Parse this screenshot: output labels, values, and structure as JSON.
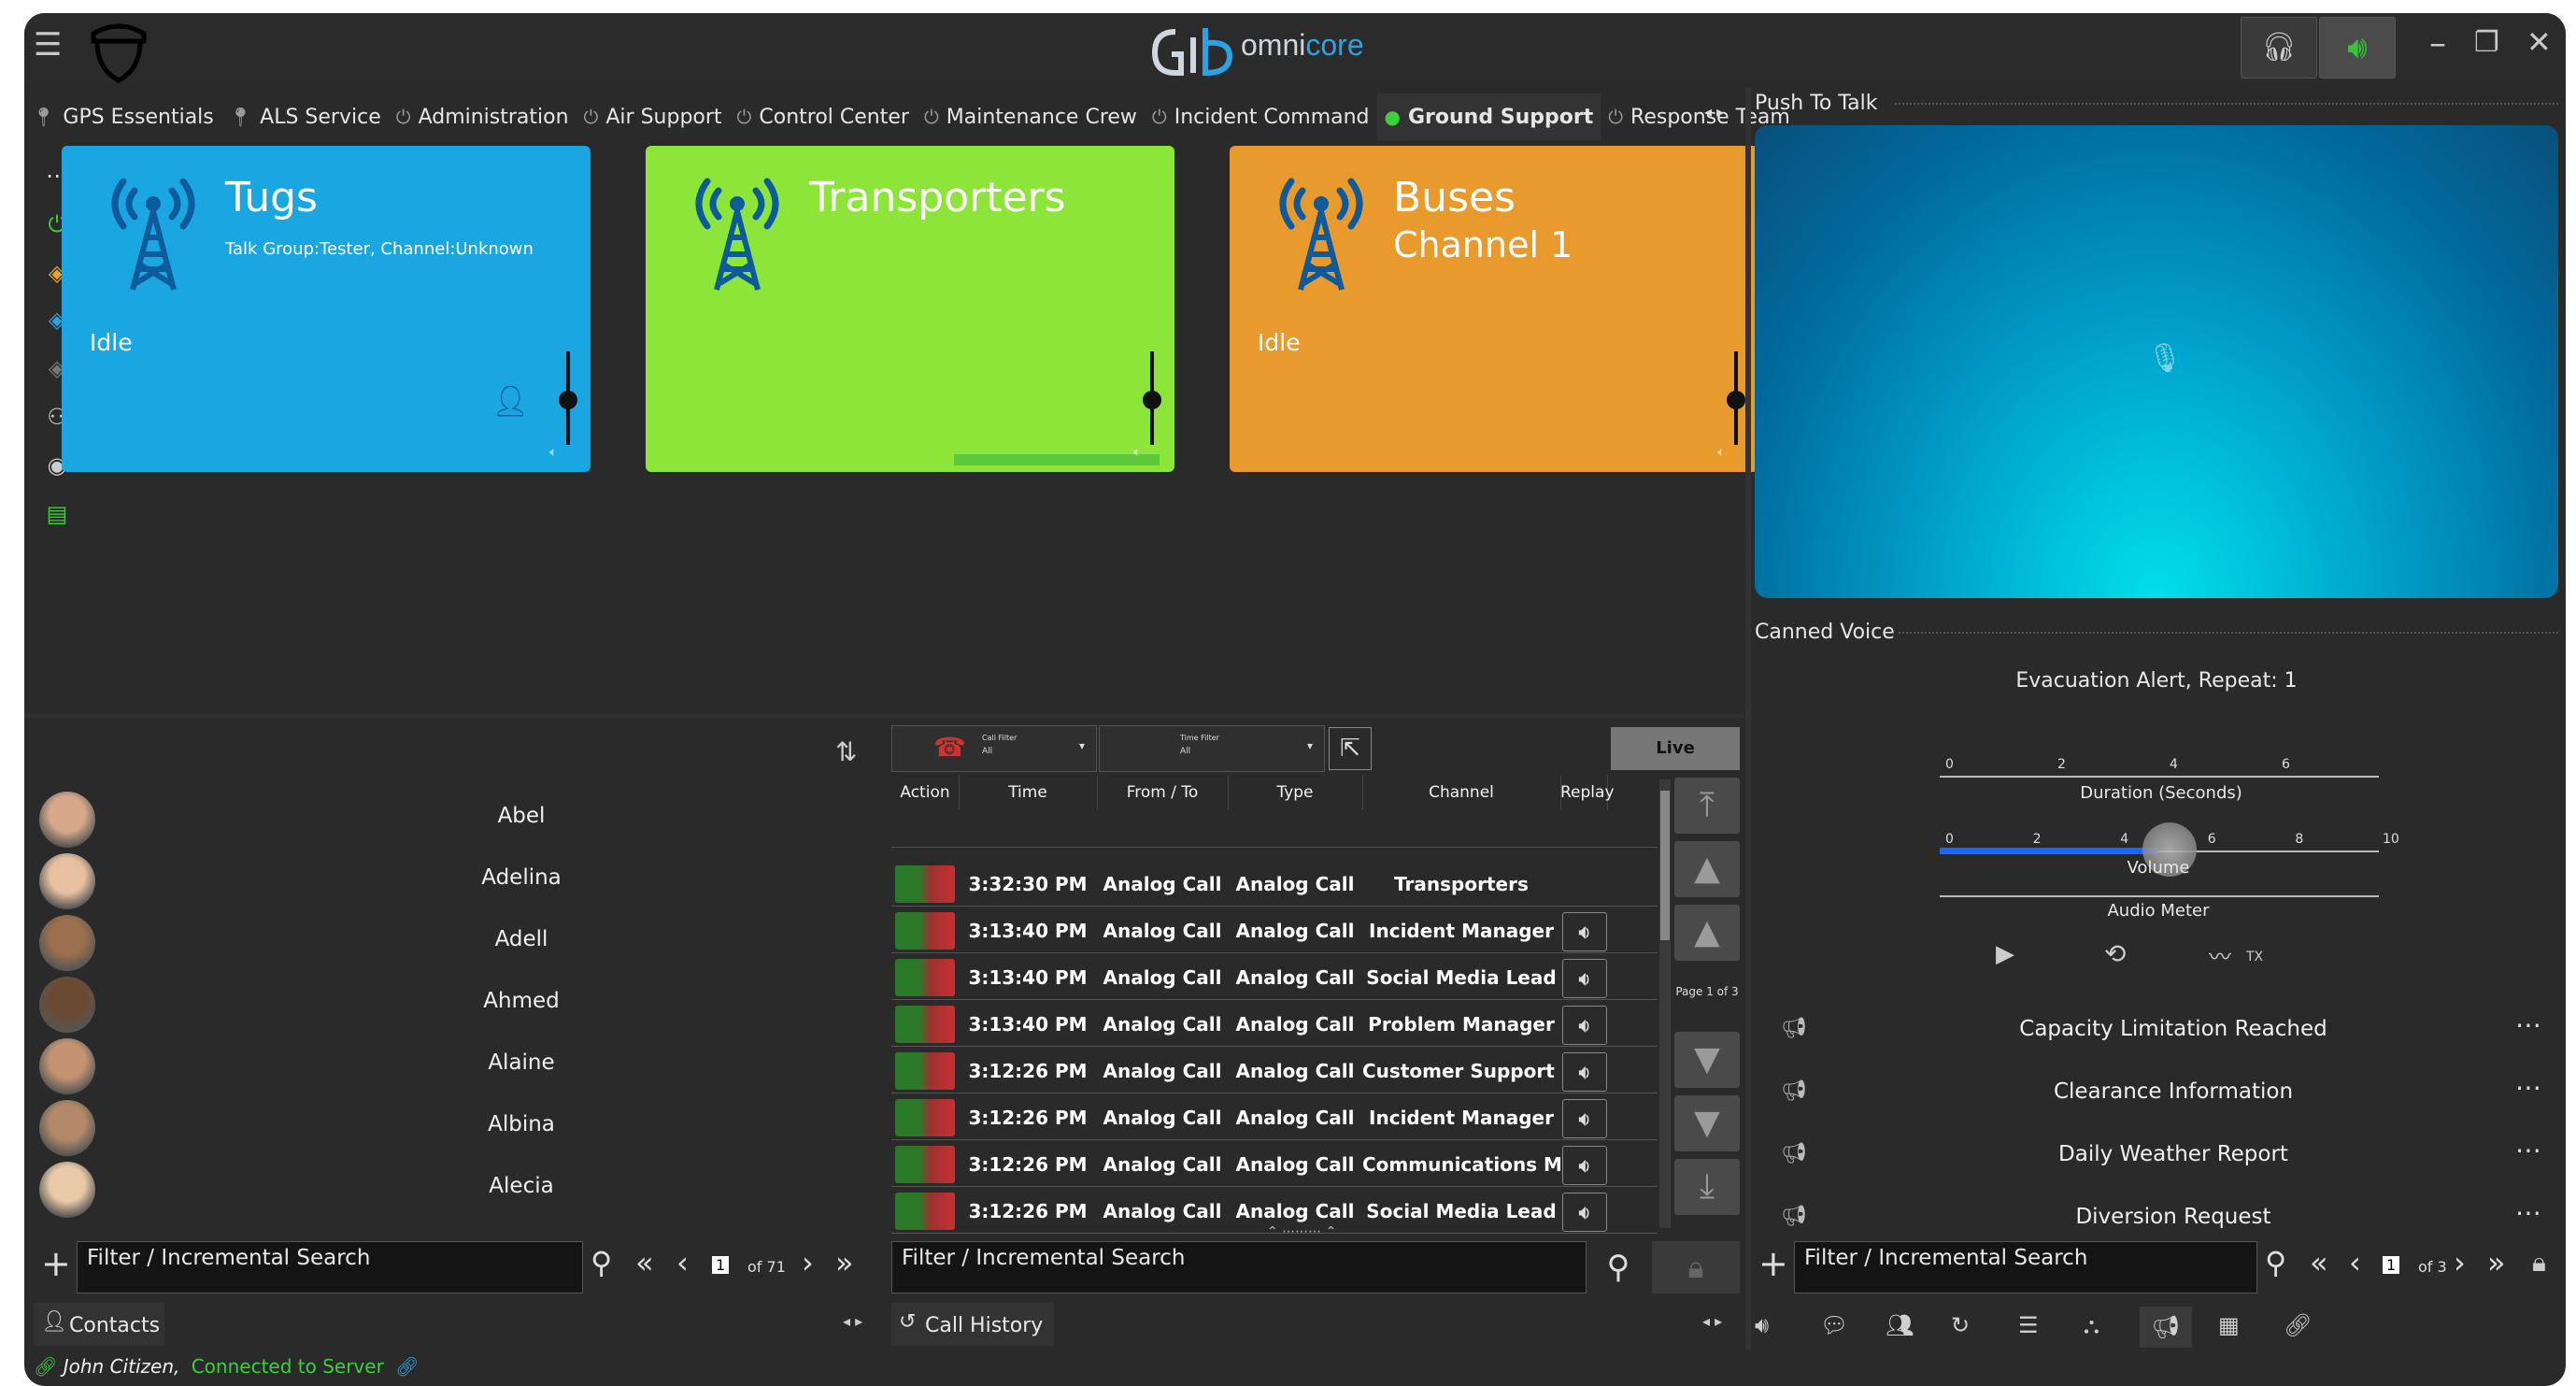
{
  "app": {
    "title_prefix": "omni",
    "title_suffix": "core"
  },
  "tabs": [
    {
      "label": "GPS Essentials",
      "icon": "location-pin-icon",
      "active": false
    },
    {
      "label": "ALS Service",
      "icon": "location-pin-icon",
      "active": false
    },
    {
      "label": "Administration",
      "icon": "power-icon",
      "active": false
    },
    {
      "label": "Air Support",
      "icon": "power-icon",
      "active": false
    },
    {
      "label": "Control Center",
      "icon": "power-icon",
      "active": false
    },
    {
      "label": "Maintenance Crew",
      "icon": "power-icon",
      "active": false
    },
    {
      "label": "Incident Command",
      "icon": "power-icon",
      "active": false
    },
    {
      "label": "Ground Support",
      "icon": "status-dot-icon",
      "active": true
    },
    {
      "label": "Response Team",
      "icon": "power-icon",
      "active": false
    }
  ],
  "cards": [
    {
      "title": "Tugs",
      "subtitle": "Talk Group:Tester, Channel:Unknown",
      "channel": "",
      "state": "Idle",
      "color": "#1aa6e0"
    },
    {
      "title": "Transporters",
      "subtitle": "",
      "channel": "",
      "state": "",
      "color": "#8ee53a"
    },
    {
      "title": "Buses",
      "subtitle": "",
      "channel": "Channel 1",
      "state": "Idle",
      "color": "#e99a2c"
    }
  ],
  "contacts": {
    "list": [
      "Abel",
      "Adelina",
      "Adell",
      "Ahmed",
      "Alaine",
      "Albina",
      "Alecia"
    ],
    "filter_placeholder": "Filter / Incremental Search",
    "page": "1",
    "page_total": "of 71",
    "panel_label": "Contacts"
  },
  "call_history": {
    "filter1_label": "Call Filter",
    "filter1_value": "All",
    "filter2_label": "Time Filter",
    "filter2_value": "All",
    "live_label": "Live",
    "headers": [
      "Action",
      "Time",
      "From / To",
      "Type",
      "Channel",
      "Replay"
    ],
    "rows": [
      {
        "time": "3:32:30 PM",
        "from": "Analog Call",
        "type": "Analog Call",
        "channel": "Transporters",
        "replay": false
      },
      {
        "time": "3:13:40 PM",
        "from": "Analog Call",
        "type": "Analog Call",
        "channel": "Incident Manager",
        "replay": true
      },
      {
        "time": "3:13:40 PM",
        "from": "Analog Call",
        "type": "Analog Call",
        "channel": "Social Media Lead",
        "replay": true
      },
      {
        "time": "3:13:40 PM",
        "from": "Analog Call",
        "type": "Analog Call",
        "channel": "Problem Manager",
        "replay": true
      },
      {
        "time": "3:12:26 PM",
        "from": "Analog Call",
        "type": "Analog Call",
        "channel": "Customer Support L...",
        "replay": true
      },
      {
        "time": "3:12:26 PM",
        "from": "Analog Call",
        "type": "Analog Call",
        "channel": "Incident Manager",
        "replay": true
      },
      {
        "time": "3:12:26 PM",
        "from": "Analog Call",
        "type": "Analog Call",
        "channel": "Communications Ma...",
        "replay": true
      },
      {
        "time": "3:12:26 PM",
        "from": "Analog Call",
        "type": "Analog Call",
        "channel": "Social Media Lead",
        "replay": true
      }
    ],
    "page_label": "Page 1 of 3",
    "filter_placeholder": "Filter / Incremental Search",
    "panel_label": "Call History"
  },
  "ptt": {
    "title": "Push To Talk"
  },
  "canned": {
    "title": "Canned Voice",
    "current": "Evacuation Alert, Repeat: 1",
    "duration_label": "Duration (Seconds)",
    "duration_ticks": [
      "0",
      "2",
      "4",
      "6"
    ],
    "volume_label": "Volume",
    "volume_ticks": [
      "0",
      "2",
      "4",
      "6",
      "8",
      "10"
    ],
    "volume_value": 5,
    "audio_meter_label": "Audio Meter",
    "tx_label": "TX",
    "items": [
      "Capacity Limitation Reached",
      "Clearance Information",
      "Daily Weather Report",
      "Diversion Request"
    ],
    "filter_placeholder": "Filter / Incremental Search",
    "page": "1",
    "page_total": "of 3"
  },
  "status": {
    "user": "John Citizen,",
    "connection": "Connected to Server"
  },
  "colors": {
    "accent_green": "#3ad13a",
    "accent_blue": "#2aa3e0"
  }
}
